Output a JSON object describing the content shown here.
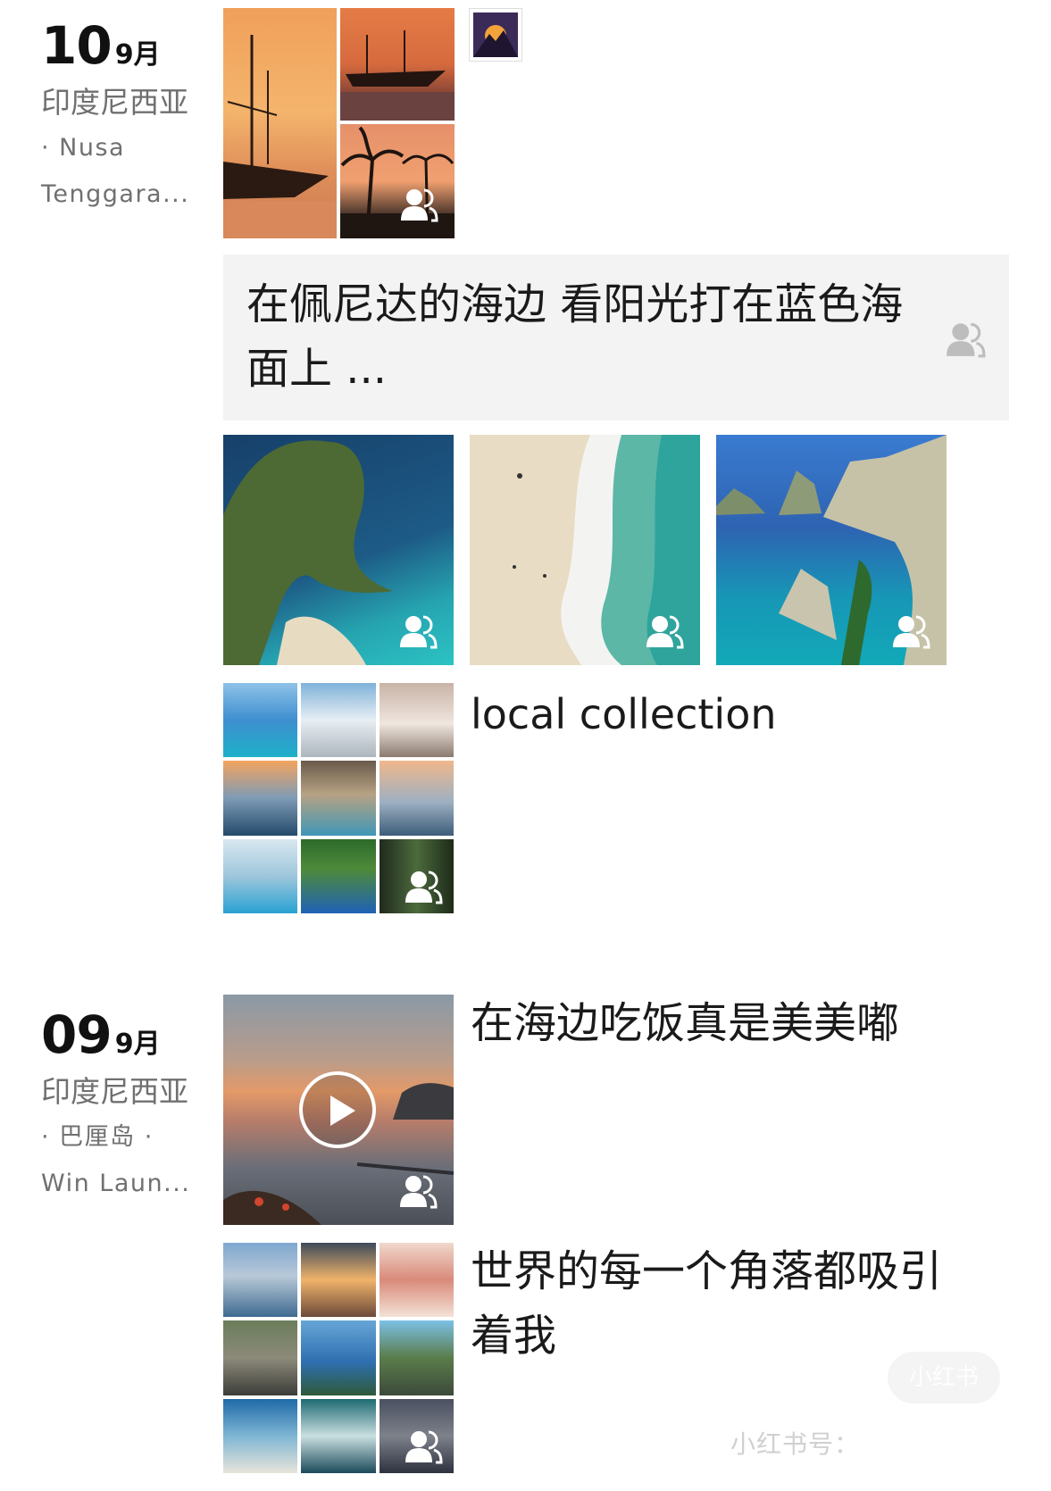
{
  "posts": [
    {
      "date": {
        "day": "10",
        "month": "9月"
      },
      "location": {
        "line1": "印度尼西亚",
        "line2": "· Nusa",
        "line3": "Tenggara..."
      },
      "title_bar_text": "在佩尼达的海边 看阳光打在蓝色海面上 ...",
      "local_collection_text": "local collection"
    },
    {
      "date": {
        "day": "09",
        "month": "9月"
      },
      "location": {
        "line1": "印度尼西亚",
        "line2": "· 巴厘岛 ·",
        "line3": "Win Laun..."
      },
      "video_caption": "在海边吃饭真是美美嘟",
      "gallery_caption": "世界的每一个角落都吸引着我"
    }
  ],
  "watermark": {
    "badge": "小红书",
    "text": "小红书号："
  },
  "icons": [
    "group-visibility-icon",
    "play-icon"
  ]
}
